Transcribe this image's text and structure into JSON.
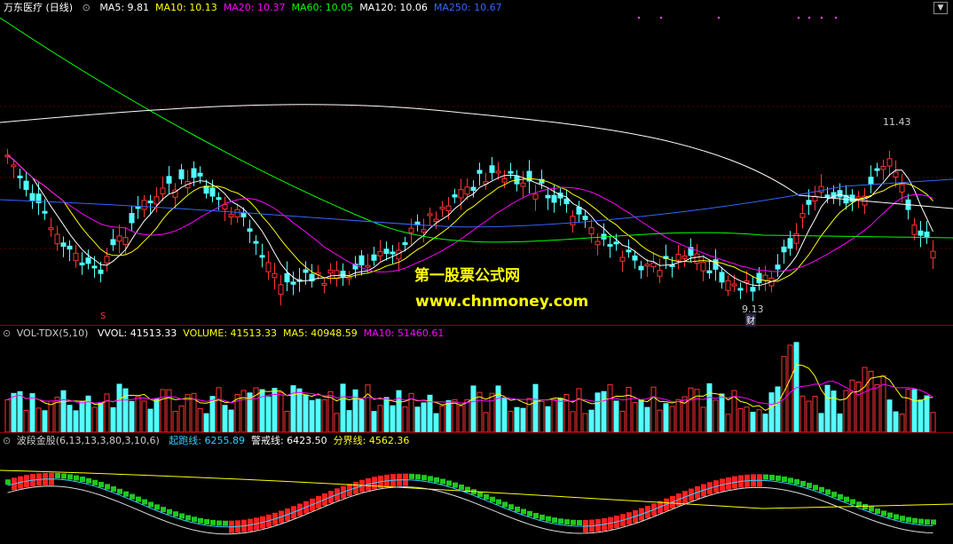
{
  "price_panel": {
    "title": "万东医疗 (日线)",
    "indicators": [
      {
        "label": "MA5: 9.81",
        "color": "#ffffff"
      },
      {
        "label": "MA10: 10.13",
        "color": "#ffff00"
      },
      {
        "label": "MA20: 10.37",
        "color": "#ff00ff"
      },
      {
        "label": "MA60: 10.05",
        "color": "#00ff00"
      },
      {
        "label": "MA120: 10.06",
        "color": "#ffffff"
      },
      {
        "label": "MA250: 10.67",
        "color": "#3366ff"
      }
    ],
    "high_label": "11.43",
    "low_label": "9.13",
    "cai_label": "财",
    "s_label": "S"
  },
  "watermark": {
    "line1": "第一股票公式网",
    "line2": "www.chnmoney.com"
  },
  "volume_panel": {
    "title": "VOL-TDX(5,10)",
    "indicators": [
      {
        "label": "VVOL: 41513.33",
        "color": "#ffffff"
      },
      {
        "label": "VOLUME: 41513.33",
        "color": "#ffff00"
      },
      {
        "label": "MA5: 40948.59",
        "color": "#ffff00"
      },
      {
        "label": "MA10: 51460.61",
        "color": "#ff00ff"
      }
    ]
  },
  "wave_panel": {
    "title": "波段金股(6,13,13,3,80,3,10,6)",
    "indicators": [
      {
        "label": "起跑线: 6255.89",
        "color": "#33ccff"
      },
      {
        "label": "警戒线: 6423.50",
        "color": "#ffffff"
      },
      {
        "label": "分界线: 4562.36",
        "color": "#ffff00"
      }
    ]
  },
  "colors": {
    "up": "#ff3333",
    "down": "#54ffff",
    "ma5": "#ffffff",
    "ma10": "#ffff00",
    "ma20": "#ff00ff",
    "ma60": "#00ff00",
    "ma120": "#ffffff",
    "ma250": "#3366ff"
  }
}
